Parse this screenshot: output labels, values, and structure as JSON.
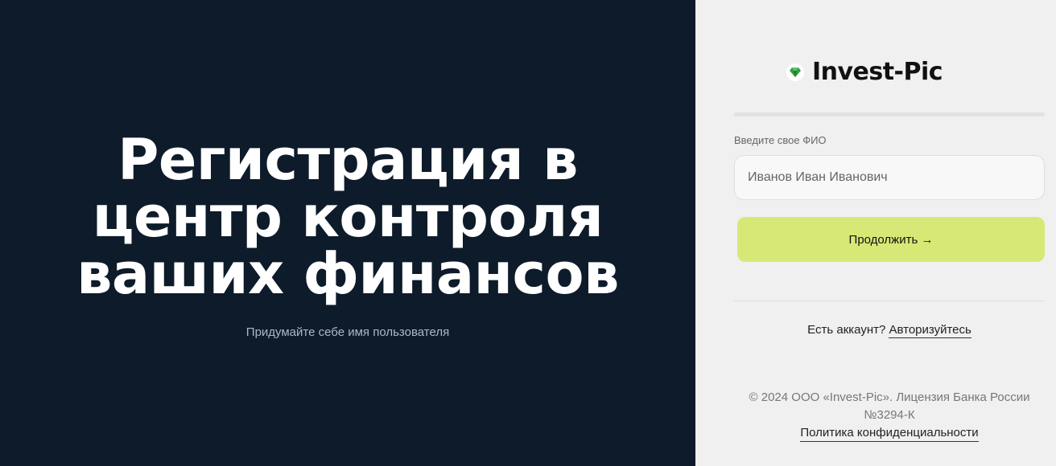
{
  "hero": {
    "title_lines": [
      "Регистрация в",
      "центр контроля",
      "ваших финансов"
    ],
    "subtitle": "Придумайте себе имя пользователя"
  },
  "brand": {
    "name": "Invest-Pic",
    "icon": "gem-icon",
    "icon_color": "#2e9e3f"
  },
  "form": {
    "label": "Введите свое ФИО",
    "placeholder": "Иванов Иван Иванович",
    "value": "",
    "submit_label": "Продолжить →"
  },
  "auth": {
    "prompt": "Есть аккаунт?",
    "link": "Авторизуйтесь"
  },
  "footer": {
    "copyright": "© 2024 ООО «Invest-Pic». Лицензия Банка России №3294-К",
    "privacy_link": "Политика конфиденциальности"
  },
  "colors": {
    "left_bg": "#0d1b2a",
    "right_bg": "#f0f0f0",
    "accent_button": "#d8e876"
  }
}
